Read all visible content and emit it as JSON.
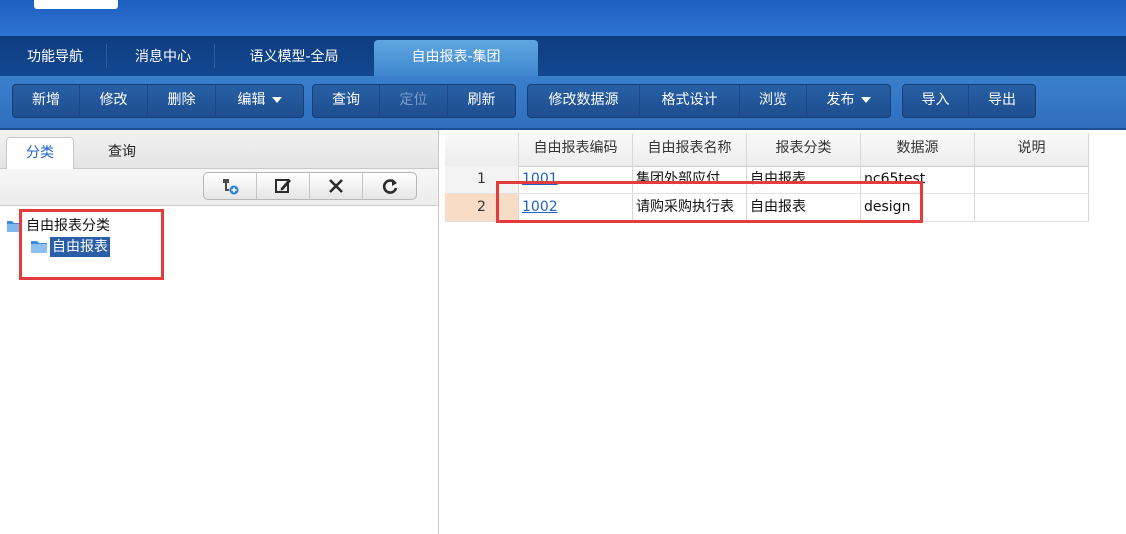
{
  "nav_tabs": [
    {
      "label": "功能导航"
    },
    {
      "label": "消息中心"
    },
    {
      "label": "语义模型-全局"
    },
    {
      "label": "自由报表-集团",
      "active": true
    }
  ],
  "toolbar": {
    "group1": [
      "新增",
      "修改",
      "删除",
      "编辑"
    ],
    "group2": [
      "查询",
      "定位",
      "刷新"
    ],
    "group3": [
      "修改数据源",
      "格式设计",
      "浏览",
      "发布"
    ],
    "group4": [
      "导入",
      "导出"
    ]
  },
  "left_panel": {
    "tabs": [
      "分类",
      "查询"
    ],
    "tree": {
      "root": "自由报表分类",
      "child": "自由报表"
    },
    "icons": [
      "add-node-icon",
      "edit-icon",
      "delete-icon",
      "refresh-icon"
    ]
  },
  "grid": {
    "columns": [
      "",
      "自由报表编码",
      "自由报表名称",
      "报表分类",
      "数据源",
      "说明"
    ],
    "rows": [
      {
        "num": "1",
        "code": "1001",
        "name": "集团外部应付...",
        "category": "自由报表",
        "source": "nc65test",
        "desc": ""
      },
      {
        "num": "2",
        "code": "1002",
        "name": "请购采购执行表",
        "category": "自由报表",
        "source": "design",
        "desc": ""
      }
    ]
  },
  "colors": {
    "nav_dark": "#124890",
    "toolbar": "#3b7fcc",
    "link": "#1d63c6",
    "highlight_box": "#e23c3c",
    "selected_node": "#2a5ea8"
  }
}
